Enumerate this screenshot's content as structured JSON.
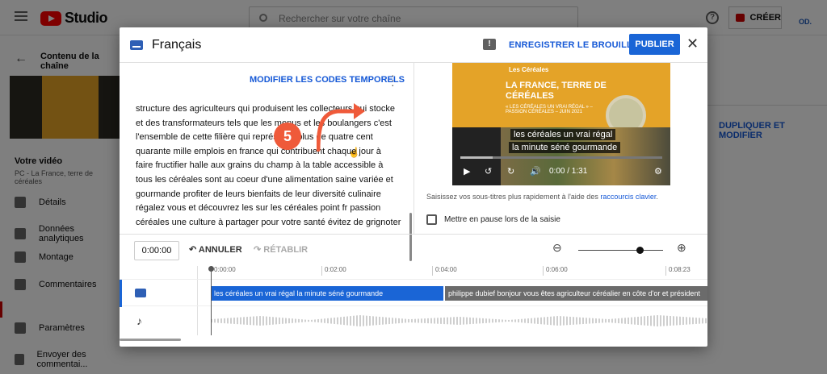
{
  "app": {
    "name": "Studio",
    "search_placeholder": "Rechercher sur votre chaîne",
    "create_label": "CRÉER",
    "avatar": "OD."
  },
  "sidebar": {
    "section": "Contenu de la chaîne",
    "video_title": "Votre vidéo",
    "video_subtitle": "PC - La France, terre de céréales",
    "items": [
      {
        "label": "Détails",
        "icon": "pencil-icon"
      },
      {
        "label": "Données analytiques",
        "icon": "analytics-icon"
      },
      {
        "label": "Montage",
        "icon": "film-icon"
      },
      {
        "label": "Commentaires",
        "icon": "comment-icon"
      },
      {
        "label": "Paramètres",
        "icon": "gear-icon"
      },
      {
        "label": "Envoyer des commentai...",
        "icon": "feedback-icon"
      }
    ]
  },
  "background_action": "DUPLIQUER ET MODIFIER",
  "dialog": {
    "title": "Français",
    "save_draft": "ENREGISTRER LE BROUILLON",
    "publish": "PUBLIER",
    "edit_timestamps": "MODIFIER LES CODES TEMPORELS",
    "step_badge": "5",
    "transcript_lines": [
      "structure des agriculteurs qui produisent les collecteurs qui stocke",
      "et des transformateurs tels que les menus et les boulangers c'est",
      "l'ensemble de cette filière qui représente plus de quatre cent",
      "quarante mille emplois en france qui contribuent chaque jour à",
      "faire fructifier halle aux grains du champ à la table accessible à",
      "tous les céréales sont au coeur d'une alimentation saine variée et",
      "gourmande profiter de leurs bienfaits de leur diversité culinaire",
      "régalez vous et découvrez les sur les céréales point fr passion",
      "céréales une culture à partager pour votre santé évitez de grignoter"
    ],
    "video": {
      "brand": "Les Céréales",
      "headline": "LA FRANCE, TERRE DE CÉRÉALES",
      "sub": "« LES CÉRÉALES UN VRAI RÉGAL » – PASSION CÉRÉALES – JUIN 2021",
      "caption_line1": "les céréales un vrai régal",
      "caption_line2": "la minute séné gourmande",
      "time": "0:00 / 1:31"
    },
    "shortcut_text": "Saisissez vos sous-titres plus rapidement à l'aide des ",
    "shortcut_link": "raccourcis clavier",
    "shortcut_end": ".",
    "pause_label": "Mettre en pause lors de la saisie",
    "timecode": "0:00:00",
    "undo": "ANNULER",
    "redo": "RÉTABLIR",
    "ruler": [
      "0:00:00",
      "0:02:00",
      "0:04:00",
      "0:06:00",
      "0:08:23"
    ],
    "segments": [
      "les céréales un vrai régal  la minute séné gourmande",
      "philippe dubief bonjour vous êtes agriculteur  céréalier en côte d'or et président"
    ]
  }
}
